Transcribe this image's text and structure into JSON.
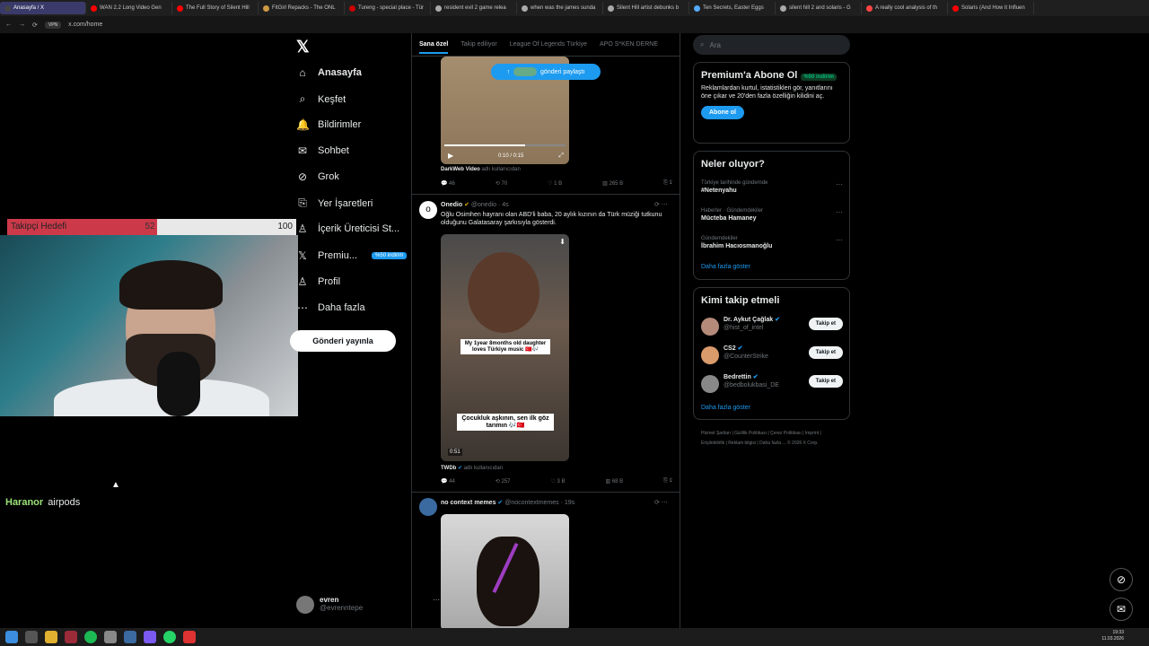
{
  "browser": {
    "tabs": [
      {
        "label": "Anasayfa / X",
        "color": "#444"
      },
      {
        "label": "WAN 2.2 Long Video Gen",
        "color": "#ff0000"
      },
      {
        "label": "The Full Story of Silent Hill",
        "color": "#ff0000"
      },
      {
        "label": "FitGirl Repacks - The ONL",
        "color": "#c94"
      },
      {
        "label": "Tureng - special place - Tür",
        "color": "#c00"
      },
      {
        "label": "resident evil 2 game relea",
        "color": "#aaa"
      },
      {
        "label": "when was the james sunda",
        "color": "#aaa"
      },
      {
        "label": "Silent Hill artist debunks b",
        "color": "#aaa"
      },
      {
        "label": "Ten Secrets, Easter Eggs",
        "color": "#5af"
      },
      {
        "label": "silent hill 2 and solaris - G",
        "color": "#aaa"
      },
      {
        "label": "A really cool analysis of th",
        "color": "#f44"
      },
      {
        "label": "Solaris (And How it Influen",
        "color": "#ff0000"
      }
    ],
    "url": "x.com/home",
    "vpn": "VPN"
  },
  "stream": {
    "goal_label": "Takipçi Hedefi",
    "goal_current": "52",
    "goal_target": "100",
    "goal_fraction": 0.52,
    "chat_user": "Haranor",
    "chat_message": "airpods"
  },
  "sidebar": {
    "logo": "𝕏",
    "items": [
      {
        "label": "Anasayfa",
        "icon": "⌂"
      },
      {
        "label": "Keşfet",
        "icon": "⌕"
      },
      {
        "label": "Bildirimler",
        "icon": "🔔"
      },
      {
        "label": "Sohbet",
        "icon": "✉"
      },
      {
        "label": "Grok",
        "icon": "⊘"
      },
      {
        "label": "Yer İşaretleri",
        "icon": "⎘"
      },
      {
        "label": "İçerik Üreticisi St...",
        "icon": "♙"
      },
      {
        "label": "Premiu...",
        "icon": "𝕏"
      },
      {
        "label": "Profil",
        "icon": "♙"
      },
      {
        "label": "Daha fazla",
        "icon": "⋯"
      }
    ],
    "premium_badge": "%50 indirim",
    "post_button": "Gönderi yayınla",
    "account_name": "evren",
    "account_handle": "@evrenntepe"
  },
  "feed": {
    "tabs": [
      "Sana özel",
      "Takip ediliyor",
      "League Of Legends Türkiye",
      "APO S*KEN DERNE"
    ],
    "share_pill": "gönderi paylaştı",
    "post1": {
      "time": "0:10 / 0:15",
      "credit_name": "DarkWeb Video",
      "credit_suffix": "adlı kullanıcıdan",
      "replies": "46",
      "reposts": "70",
      "likes": "1 B",
      "views": "265 B"
    },
    "post2": {
      "name": "Onedio",
      "handle": "@onedio · 4s",
      "text": "Oğlu Osimhen hayranı olan ABD'li baba, 20 aylık kızının da Türk müziği tutkunu olduğunu Galatasaray şarkısıyla gösterdi.",
      "caption_top": "My 1year 8months old daughter loves Türkiye music 🇹🇷🎶",
      "caption_bottom": "Çocukluk aşkının, sen ilk göz tarımın 🎶🇹🇷",
      "duration": "0:51",
      "credit_name": "TWDb",
      "credit_suffix": "adlı kullanıcıdan",
      "replies": "44",
      "reposts": "257",
      "likes": "3 B",
      "views": "68 B"
    },
    "post3": {
      "name": "no context memes",
      "handle": "@nocontextmemes · 19s"
    }
  },
  "right": {
    "search_placeholder": "Ara",
    "premium_title": "Premium'a Abone Ol",
    "premium_badge": "%50 indirim",
    "premium_text": "Reklamlardan kurtul, istatistikleri gör, yanıtlarını öne çıkar ve 20'den fazla özelliğin kilidini aç.",
    "premium_button": "Abone ol",
    "trends_title": "Neler oluyor?",
    "trends": [
      {
        "context": "Türkiye tarihinde gündemde",
        "topic": "#Netenyahu"
      },
      {
        "context": "Haberler · Gündemdekiler",
        "topic": "Mücteba Hamaney"
      },
      {
        "context": "Gündemdekiler",
        "topic": "İbrahim Hacıosmanoğlu"
      }
    ],
    "trends_more": "Daha fazla göster",
    "who_title": "Kimi takip etmeli",
    "who": [
      {
        "name": "Dr. Aykut Çağlak",
        "handle": "@hist_of_intel",
        "color": "#b48a7a"
      },
      {
        "name": "CS2",
        "handle": "@CounterStrike",
        "color": "#d99a6c"
      },
      {
        "name": "Bedrettin",
        "handle": "@bedbolukbasi_DE",
        "color": "#888"
      }
    ],
    "follow_label": "Takip et",
    "who_more": "Daha fazla göster",
    "footer": "Hizmet Şartları | Gizlilik Politikası | Çerez Politikası | Imprint | Erişilebilirlik | Reklam bilgisi | Daha fazla ... © 2026 X Corp."
  },
  "system": {
    "time": "19:33",
    "date": "11.03.2026"
  }
}
